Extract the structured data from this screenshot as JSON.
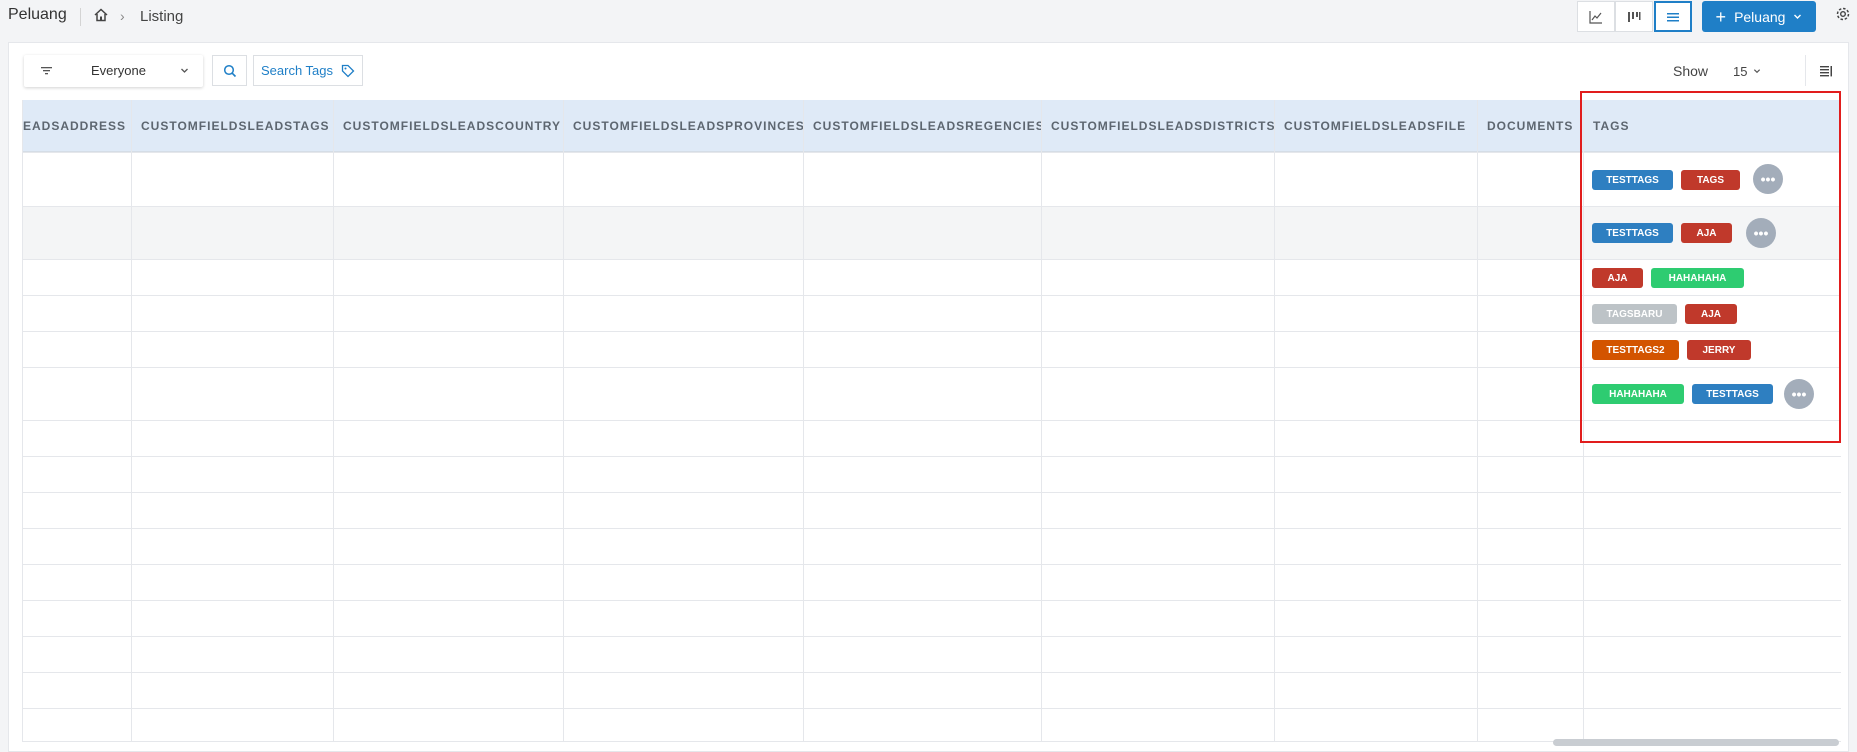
{
  "header": {
    "app_title": "Peluang",
    "breadcrumb": "Listing",
    "new_button_label": "Peluang"
  },
  "toolbar": {
    "filter_value": "Everyone",
    "search_tags_label": "Search Tags",
    "show_label": "Show",
    "show_value": "15"
  },
  "table": {
    "columns": [
      "EADSADDRESS",
      "CUSTOMFIELDSLEADSTAGS",
      "CUSTOMFIELDSLEADSCOUNTRY",
      "CUSTOMFIELDSLEADSPROVINCES",
      "CUSTOMFIELDSLEADSREGENCIES",
      "CUSTOMFIELDSLEADSDISTRICTS",
      "CUSTOMFIELDSLEADSFILE",
      "DOCUMENTS",
      "TAGS"
    ],
    "tag_rows": [
      {
        "tags": [
          {
            "label": "TESTTAGS",
            "color": "#2e7fc1"
          },
          {
            "label": "TAGS",
            "color": "#c0392b"
          }
        ],
        "more": true
      },
      {
        "tags": [
          {
            "label": "TESTTAGS",
            "color": "#2e7fc1"
          },
          {
            "label": "AJA",
            "color": "#c0392b"
          }
        ],
        "more": true
      },
      {
        "tags": [
          {
            "label": "AJA",
            "color": "#c0392b"
          },
          {
            "label": "HAHAHAHA",
            "color": "#2ecc71"
          }
        ],
        "more": false
      },
      {
        "tags": [
          {
            "label": "TAGSBARU",
            "color": "#bdc3c7"
          },
          {
            "label": "AJA",
            "color": "#c0392b"
          }
        ],
        "more": false
      },
      {
        "tags": [
          {
            "label": "TESTTAGS2",
            "color": "#d35400"
          },
          {
            "label": "JERRY",
            "color": "#c0392b"
          }
        ],
        "more": false
      },
      {
        "tags": [
          {
            "label": "HAHAHAHA",
            "color": "#2ecc71"
          },
          {
            "label": "TESTTAGS",
            "color": "#2e7fc1"
          }
        ],
        "more": true
      }
    ],
    "more_glyph": "•••"
  },
  "colors": {
    "primary": "#1f7fc7",
    "header_bg": "#dfeaf7",
    "highlight": "#e11d1d"
  },
  "icons": [
    "home-icon",
    "chevron-right-icon",
    "line-chart-icon",
    "kanban-icon",
    "list-icon",
    "plus-icon",
    "chevron-down-icon",
    "gear-icon",
    "filter-icon",
    "search-icon",
    "tag-icon",
    "columns-icon"
  ]
}
